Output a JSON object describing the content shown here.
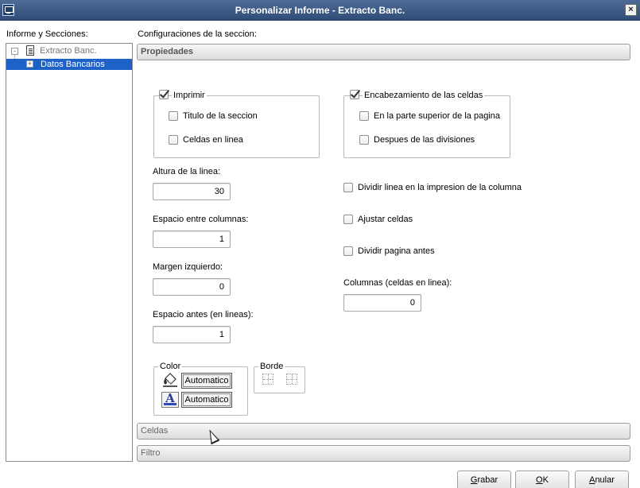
{
  "window": {
    "title": "Personalizar Informe - Extracto Banc.",
    "close_glyph": "×"
  },
  "left_panel": {
    "label": "Informe y Secciones:",
    "tree": [
      {
        "label": "Extracto Banc.",
        "expander": "-",
        "icon": "document-icon"
      },
      {
        "label": "Datos Bancarios",
        "expander": "+",
        "selected": true
      }
    ]
  },
  "main": {
    "label": "Configuraciones de la seccion:",
    "sections": {
      "propiedades": "Propiedades",
      "celdas": "Celdas",
      "filtro": "Filtro"
    }
  },
  "imprimir_group": {
    "label": "Imprimir",
    "checked": true,
    "options": [
      {
        "label": "Titulo de la seccion",
        "checked": false
      },
      {
        "label": "Celdas en linea",
        "checked": false
      }
    ]
  },
  "encabezamiento_group": {
    "label": "Encabezamiento de las celdas",
    "checked": true,
    "options": [
      {
        "label": "En la parte superior de la pagina",
        "checked": false
      },
      {
        "label": "Despues de las divisiones",
        "checked": false
      }
    ]
  },
  "fields": {
    "altura_linea": {
      "label": "Altura de la linea:",
      "value": "30"
    },
    "espacio_columnas": {
      "label": "Espacio entre columnas:",
      "value": "1"
    },
    "margen_izquierdo": {
      "label": "Margen izquierdo:",
      "value": "0"
    },
    "espacio_antes": {
      "label": "Espacio antes (en lineas):",
      "value": "1"
    },
    "columnas": {
      "label": "Columnas (celdas en linea):",
      "value": "0"
    }
  },
  "right_options": [
    {
      "label": "Dividir linea en la impresion de la columna",
      "checked": false
    },
    {
      "label": "Ajustar celdas",
      "checked": false
    },
    {
      "label": "Dividir pagina antes",
      "checked": false
    }
  ],
  "color_group": {
    "label": "Color",
    "fill_value": "Automatico",
    "font_value": "Automatico",
    "fill_icon": "paint-bucket-icon",
    "font_icon": "font-color-icon"
  },
  "borde_group": {
    "label": "Borde"
  },
  "buttons": {
    "grabar": "Grabar",
    "ok": "OK",
    "anular": "Anular"
  }
}
